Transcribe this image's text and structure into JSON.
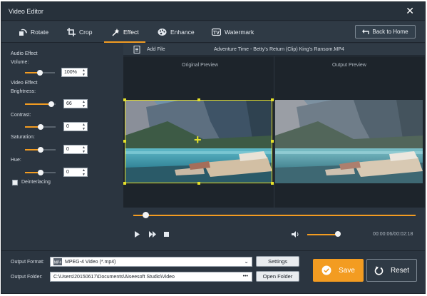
{
  "window": {
    "title": "Video Editor"
  },
  "toolbar": {
    "tabs": [
      {
        "label": "Rotate",
        "icon": "rotate-icon"
      },
      {
        "label": "Crop",
        "icon": "crop-icon"
      },
      {
        "label": "Effect",
        "icon": "effect-icon",
        "active": true
      },
      {
        "label": "Enhance",
        "icon": "palette-icon"
      },
      {
        "label": "Watermark",
        "icon": "watermark-icon"
      }
    ],
    "back_label": "Back to Home"
  },
  "effects": {
    "audio_header": "Audio Effect",
    "volume_label": "Volume:",
    "volume_value": "100%",
    "volume_level": 0.6,
    "video_header": "Video Effect",
    "brightness_label": "Brightness:",
    "brightness_value": "66",
    "brightness_level": 0.75,
    "contrast_label": "Contrast:",
    "contrast_value": "0",
    "contrast_level": 0.5,
    "saturation_label": "Saturation:",
    "saturation_value": "0",
    "saturation_level": 0.5,
    "hue_label": "Hue:",
    "hue_value": "0",
    "hue_level": 0.5,
    "deinterlacing_label": "Deinterlacing",
    "deinterlacing_checked": false
  },
  "file": {
    "add_label": "Add File",
    "name": "Adventure Time - Betty's Return (Clip) King's Ransom.MP4"
  },
  "preview": {
    "original_label": "Original Preview",
    "output_label": "Output Preview"
  },
  "player": {
    "progress": 0.05,
    "volume_level": 0.75,
    "time": "00:00:06/00:02:18"
  },
  "output": {
    "format_label": "Output Format:",
    "format_value": "MPEG-4 Video (*.mp4)",
    "settings_label": "Settings",
    "folder_label": "Output Folder:",
    "folder_value": "C:\\Users\\20150617\\Documents\\Aiseesoft Studio\\Video",
    "browse_label": "•••",
    "open_folder_label": "Open Folder"
  },
  "actions": {
    "save_label": "Save",
    "reset_label": "Reset"
  },
  "colors": {
    "accent": "#f39c21",
    "selection": "#e5e02a",
    "background": "#2b3540"
  }
}
